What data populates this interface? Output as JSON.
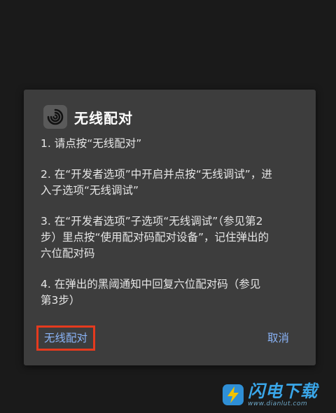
{
  "dialog": {
    "title": "无线配对",
    "icon": "swirl-app-icon",
    "instructions": [
      "1. 请点按“无线配对”",
      "2. 在“开发者选项”中开启并点按“无线调试”，进\n入子选项“无线调试”",
      "3. 在“开发者选项”子选项“无线调试”（参见第2\n步）里点按“使用配对码配对设备”，记住弹出的\n六位配对码",
      "4. 在弹出的黑阈通知中回复六位配对码（参见\n第3步）"
    ],
    "buttons": {
      "primary_label": "无线配对",
      "cancel_label": "取消"
    }
  },
  "watermark": {
    "site_name": "闪电下载",
    "url": "www.dianlut.com"
  },
  "colors": {
    "background": "#1a1a1a",
    "dialog_bg": "#3d3d3d",
    "accent": "#8ab4f8",
    "highlight_border": "#e53a1e",
    "watermark": "#3aa6e8"
  }
}
